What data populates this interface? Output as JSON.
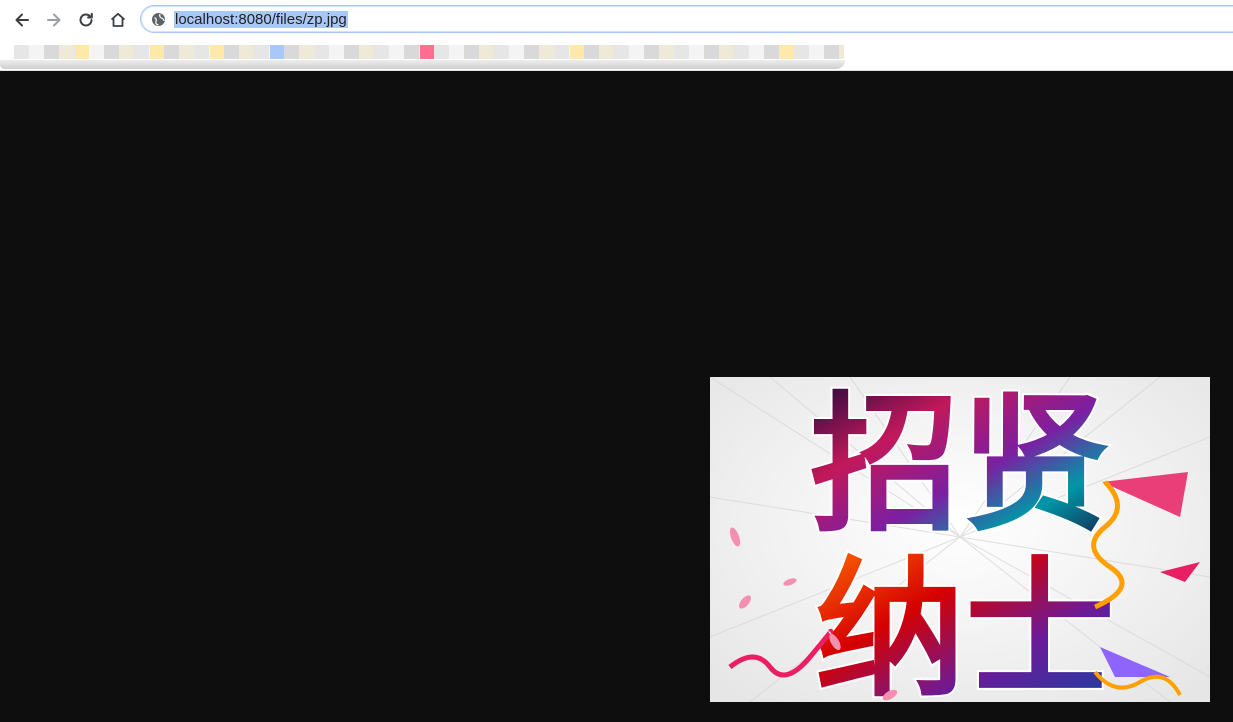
{
  "browser": {
    "url": "localhost:8080/files/zp.jpg",
    "nav": {
      "back_icon": "arrow-left-icon",
      "forward_icon": "arrow-right-icon",
      "reload_icon": "reload-icon",
      "home_icon": "home-icon",
      "site_info_icon": "globe-icon"
    }
  },
  "page": {
    "background": "#0e0e0e",
    "image": {
      "file": "zp.jpg",
      "text_line1": "招贤",
      "text_line2": "纳士"
    }
  },
  "colors": {
    "accent_highlight": "#a8c7fa",
    "bookmark_chip_yellow": "#ffe9a8",
    "bookmark_chip_blue": "#a8c7fa",
    "bookmark_chip_pink": "#ff6f91"
  }
}
